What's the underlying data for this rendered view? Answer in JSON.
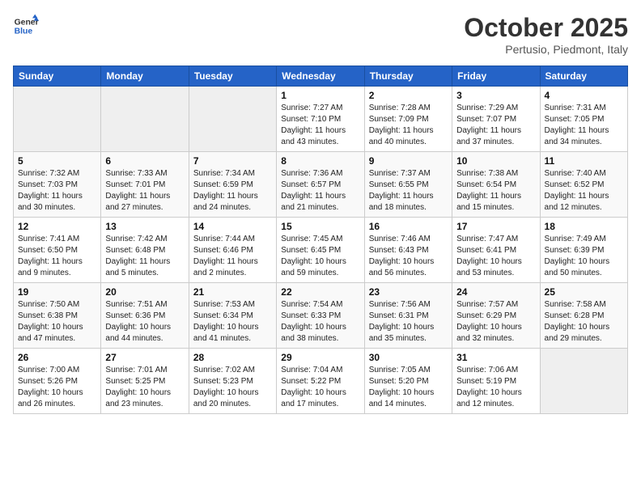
{
  "logo": {
    "line1": "General",
    "line2": "Blue"
  },
  "title": "October 2025",
  "subtitle": "Pertusio, Piedmont, Italy",
  "days_of_week": [
    "Sunday",
    "Monday",
    "Tuesday",
    "Wednesday",
    "Thursday",
    "Friday",
    "Saturday"
  ],
  "weeks": [
    [
      {
        "day": "",
        "info": ""
      },
      {
        "day": "",
        "info": ""
      },
      {
        "day": "",
        "info": ""
      },
      {
        "day": "1",
        "info": "Sunrise: 7:27 AM\nSunset: 7:10 PM\nDaylight: 11 hours\nand 43 minutes."
      },
      {
        "day": "2",
        "info": "Sunrise: 7:28 AM\nSunset: 7:09 PM\nDaylight: 11 hours\nand 40 minutes."
      },
      {
        "day": "3",
        "info": "Sunrise: 7:29 AM\nSunset: 7:07 PM\nDaylight: 11 hours\nand 37 minutes."
      },
      {
        "day": "4",
        "info": "Sunrise: 7:31 AM\nSunset: 7:05 PM\nDaylight: 11 hours\nand 34 minutes."
      }
    ],
    [
      {
        "day": "5",
        "info": "Sunrise: 7:32 AM\nSunset: 7:03 PM\nDaylight: 11 hours\nand 30 minutes."
      },
      {
        "day": "6",
        "info": "Sunrise: 7:33 AM\nSunset: 7:01 PM\nDaylight: 11 hours\nand 27 minutes."
      },
      {
        "day": "7",
        "info": "Sunrise: 7:34 AM\nSunset: 6:59 PM\nDaylight: 11 hours\nand 24 minutes."
      },
      {
        "day": "8",
        "info": "Sunrise: 7:36 AM\nSunset: 6:57 PM\nDaylight: 11 hours\nand 21 minutes."
      },
      {
        "day": "9",
        "info": "Sunrise: 7:37 AM\nSunset: 6:55 PM\nDaylight: 11 hours\nand 18 minutes."
      },
      {
        "day": "10",
        "info": "Sunrise: 7:38 AM\nSunset: 6:54 PM\nDaylight: 11 hours\nand 15 minutes."
      },
      {
        "day": "11",
        "info": "Sunrise: 7:40 AM\nSunset: 6:52 PM\nDaylight: 11 hours\nand 12 minutes."
      }
    ],
    [
      {
        "day": "12",
        "info": "Sunrise: 7:41 AM\nSunset: 6:50 PM\nDaylight: 11 hours\nand 9 minutes."
      },
      {
        "day": "13",
        "info": "Sunrise: 7:42 AM\nSunset: 6:48 PM\nDaylight: 11 hours\nand 5 minutes."
      },
      {
        "day": "14",
        "info": "Sunrise: 7:44 AM\nSunset: 6:46 PM\nDaylight: 11 hours\nand 2 minutes."
      },
      {
        "day": "15",
        "info": "Sunrise: 7:45 AM\nSunset: 6:45 PM\nDaylight: 10 hours\nand 59 minutes."
      },
      {
        "day": "16",
        "info": "Sunrise: 7:46 AM\nSunset: 6:43 PM\nDaylight: 10 hours\nand 56 minutes."
      },
      {
        "day": "17",
        "info": "Sunrise: 7:47 AM\nSunset: 6:41 PM\nDaylight: 10 hours\nand 53 minutes."
      },
      {
        "day": "18",
        "info": "Sunrise: 7:49 AM\nSunset: 6:39 PM\nDaylight: 10 hours\nand 50 minutes."
      }
    ],
    [
      {
        "day": "19",
        "info": "Sunrise: 7:50 AM\nSunset: 6:38 PM\nDaylight: 10 hours\nand 47 minutes."
      },
      {
        "day": "20",
        "info": "Sunrise: 7:51 AM\nSunset: 6:36 PM\nDaylight: 10 hours\nand 44 minutes."
      },
      {
        "day": "21",
        "info": "Sunrise: 7:53 AM\nSunset: 6:34 PM\nDaylight: 10 hours\nand 41 minutes."
      },
      {
        "day": "22",
        "info": "Sunrise: 7:54 AM\nSunset: 6:33 PM\nDaylight: 10 hours\nand 38 minutes."
      },
      {
        "day": "23",
        "info": "Sunrise: 7:56 AM\nSunset: 6:31 PM\nDaylight: 10 hours\nand 35 minutes."
      },
      {
        "day": "24",
        "info": "Sunrise: 7:57 AM\nSunset: 6:29 PM\nDaylight: 10 hours\nand 32 minutes."
      },
      {
        "day": "25",
        "info": "Sunrise: 7:58 AM\nSunset: 6:28 PM\nDaylight: 10 hours\nand 29 minutes."
      }
    ],
    [
      {
        "day": "26",
        "info": "Sunrise: 7:00 AM\nSunset: 5:26 PM\nDaylight: 10 hours\nand 26 minutes."
      },
      {
        "day": "27",
        "info": "Sunrise: 7:01 AM\nSunset: 5:25 PM\nDaylight: 10 hours\nand 23 minutes."
      },
      {
        "day": "28",
        "info": "Sunrise: 7:02 AM\nSunset: 5:23 PM\nDaylight: 10 hours\nand 20 minutes."
      },
      {
        "day": "29",
        "info": "Sunrise: 7:04 AM\nSunset: 5:22 PM\nDaylight: 10 hours\nand 17 minutes."
      },
      {
        "day": "30",
        "info": "Sunrise: 7:05 AM\nSunset: 5:20 PM\nDaylight: 10 hours\nand 14 minutes."
      },
      {
        "day": "31",
        "info": "Sunrise: 7:06 AM\nSunset: 5:19 PM\nDaylight: 10 hours\nand 12 minutes."
      },
      {
        "day": "",
        "info": ""
      }
    ]
  ]
}
